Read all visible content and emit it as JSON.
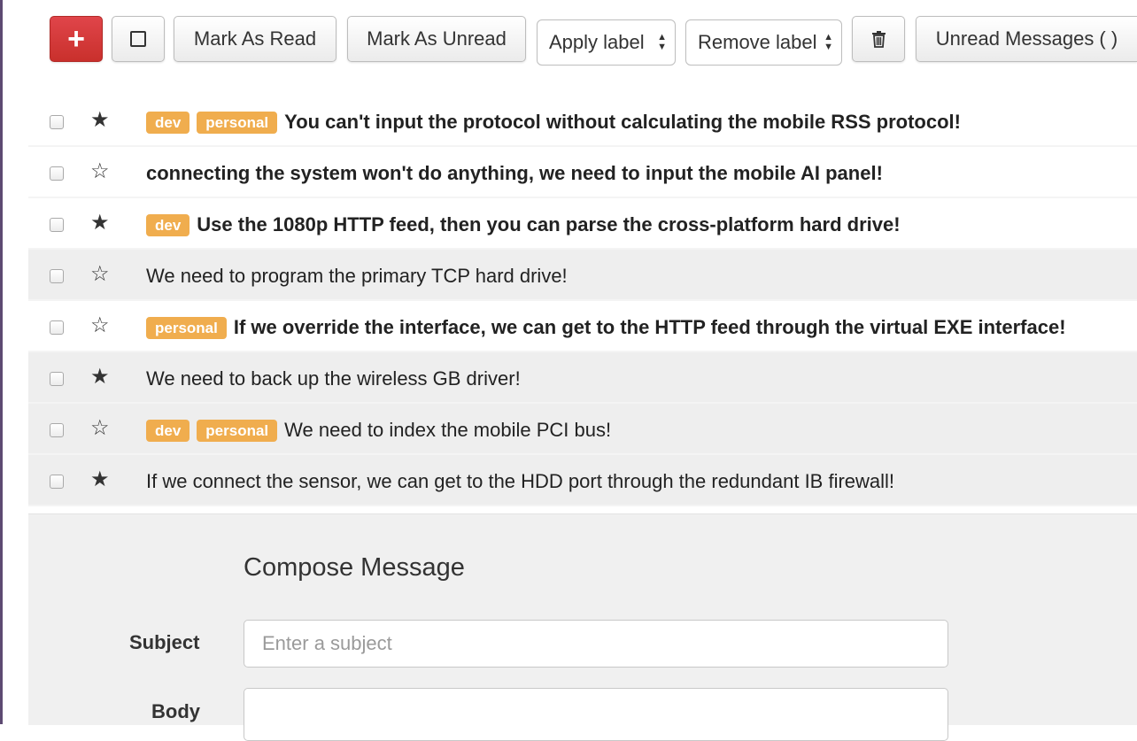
{
  "toolbar": {
    "compose_icon": "plus-icon",
    "select_icon": "square-icon",
    "mark_read_label": "Mark As Read",
    "mark_unread_label": "Mark As Unread",
    "apply_label": "Apply label",
    "remove_label": "Remove label",
    "delete_icon": "trash-icon",
    "unread_messages_label": "Unread Messages ( )",
    "compose_color": "#d9534f"
  },
  "messages": [
    {
      "read": false,
      "starred": true,
      "labels": [
        "dev",
        "personal"
      ],
      "subject": "You can't input the protocol without calculating the mobile RSS protocol!"
    },
    {
      "read": false,
      "starred": false,
      "labels": [],
      "subject": "connecting the system won't do anything, we need to input the mobile AI panel!"
    },
    {
      "read": false,
      "starred": true,
      "labels": [
        "dev"
      ],
      "subject": "Use the 1080p HTTP feed, then you can parse the cross-platform hard drive!"
    },
    {
      "read": true,
      "starred": false,
      "labels": [],
      "subject": "We need to program the primary TCP hard drive!"
    },
    {
      "read": false,
      "starred": false,
      "labels": [
        "personal"
      ],
      "subject": "If we override the interface, we can get to the HTTP feed through the virtual EXE interface!"
    },
    {
      "read": true,
      "starred": true,
      "labels": [],
      "subject": "We need to back up the wireless GB driver!"
    },
    {
      "read": true,
      "starred": false,
      "labels": [
        "dev",
        "personal"
      ],
      "subject": "We need to index the mobile PCI bus!"
    },
    {
      "read": true,
      "starred": true,
      "labels": [],
      "subject": "If we connect the sensor, we can get to the HDD port through the redundant IB firewall!"
    }
  ],
  "label_color": "#f0ad4e",
  "compose": {
    "title": "Compose Message",
    "subject_label": "Subject",
    "subject_placeholder": "Enter a subject",
    "subject_value": "",
    "body_label": "Body",
    "body_value": ""
  }
}
